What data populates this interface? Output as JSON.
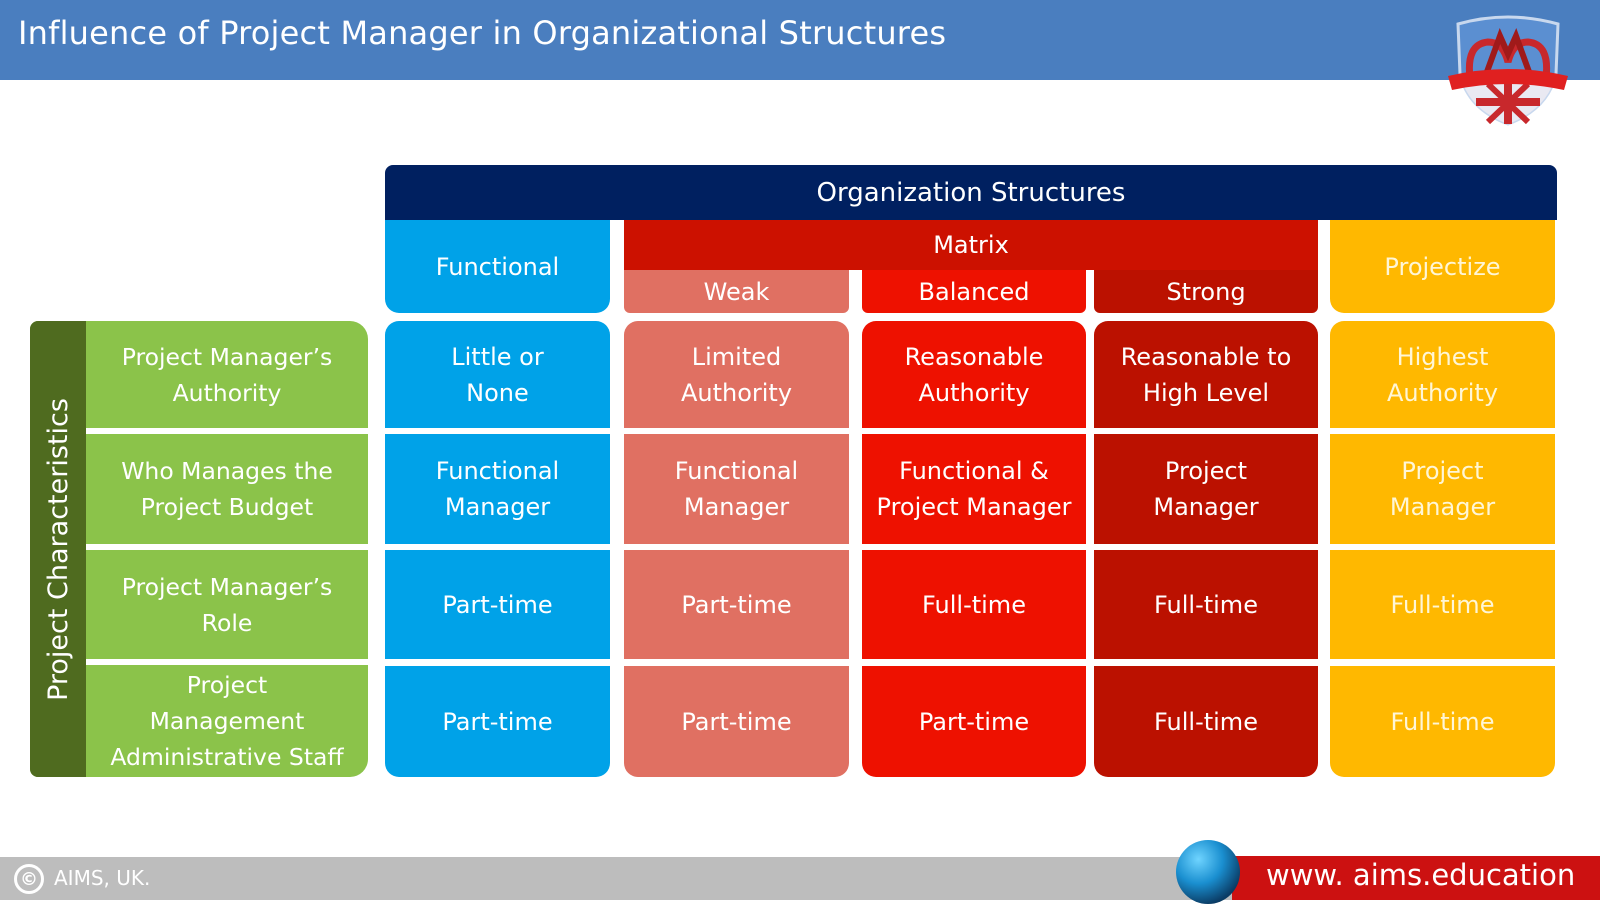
{
  "header": {
    "title": "Influence of Project Manager in Organizational Structures",
    "logo": "aims-crest-logo"
  },
  "table": {
    "super_header": "Organization Structures",
    "structures": {
      "functional": "Functional",
      "matrix": "Matrix",
      "weak": "Weak",
      "balanced": "Balanced",
      "strong": "Strong",
      "projectize": "Projectize"
    },
    "row_group_label": "Project Characteristics",
    "rows": [
      {
        "label_lines": [
          "Project Manager’s",
          "Authority"
        ],
        "cells": [
          [
            "Little or",
            "None"
          ],
          [
            "Limited",
            "Authority"
          ],
          [
            "Reasonable",
            "Authority"
          ],
          [
            "Reasonable to",
            "High Level"
          ],
          [
            "Highest",
            "Authority"
          ]
        ]
      },
      {
        "label_lines": [
          "Who Manages the",
          "Project Budget"
        ],
        "cells": [
          [
            "Functional",
            "Manager"
          ],
          [
            "Functional",
            "Manager"
          ],
          [
            "Functional &",
            "Project Manager"
          ],
          [
            "Project",
            "Manager"
          ],
          [
            "Project",
            "Manager"
          ]
        ]
      },
      {
        "label_lines": [
          "Project Manager’s",
          "Role"
        ],
        "cells": [
          [
            "Part-time"
          ],
          [
            "Part-time"
          ],
          [
            "Full-time"
          ],
          [
            "Full-time"
          ],
          [
            "Full-time"
          ]
        ]
      },
      {
        "label_lines": [
          "Project",
          "Management",
          "Administrative Staff"
        ],
        "cells": [
          [
            "Part-time"
          ],
          [
            "Part-time"
          ],
          [
            "Part-time"
          ],
          [
            "Full-time"
          ],
          [
            "Full-time"
          ]
        ]
      }
    ],
    "colors": {
      "super_header": "#002060",
      "functional": "#00a2e8",
      "matrix": "#cc1100",
      "weak": "#e07062",
      "balanced": "#ee1100",
      "strong": "#bb1100",
      "projectize": "#ffb800",
      "characteristics": "#8bc34a",
      "characteristics_strip": "#4f6b1f"
    }
  },
  "footer": {
    "copyright_symbol": "©",
    "copyright": "AIMS, UK.",
    "url": "www. aims.education",
    "globe_icon": "globe-icon"
  }
}
